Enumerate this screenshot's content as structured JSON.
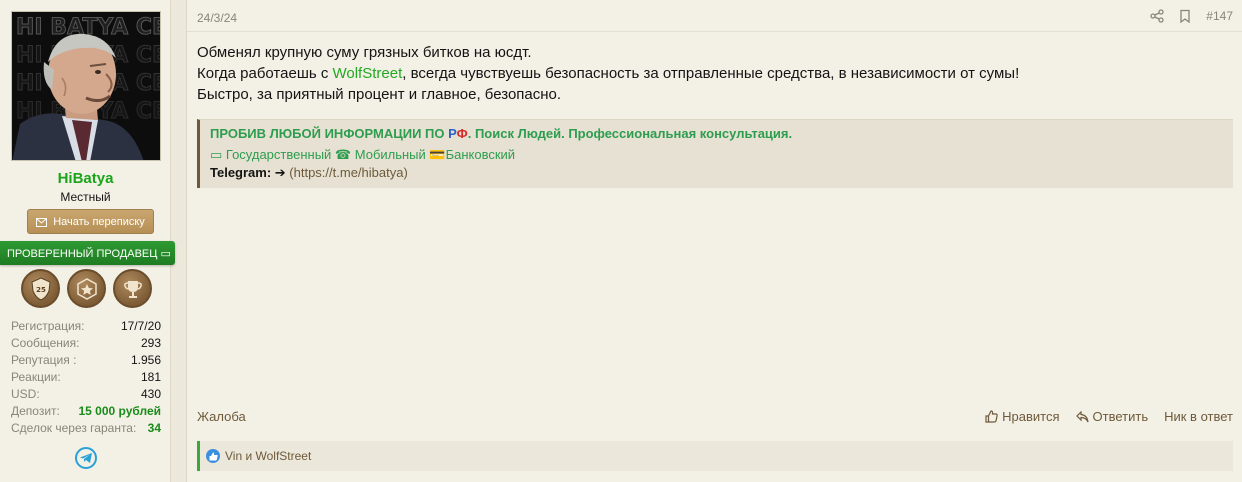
{
  "user": {
    "avatar_text": "HI BATYA СЕРВИС",
    "username": "HiBatya",
    "title": "Местный",
    "pm_button": "Начать переписку",
    "verified_label": "ПРОВЕРЕННЫЙ ПРОДАВЕЦ ▭",
    "trophy_number": "25",
    "stats": [
      {
        "label": "Регистрация:",
        "value": "17/7/20",
        "highlight": false
      },
      {
        "label": "Сообщения:",
        "value": "293",
        "highlight": false
      },
      {
        "label": "Репутация :",
        "value": "1.956",
        "highlight": false
      },
      {
        "label": "Реакции:",
        "value": "181",
        "highlight": false
      },
      {
        "label": "USD:",
        "value": "430",
        "highlight": false
      },
      {
        "label": "Депозит:",
        "value": "15 000 рублей",
        "highlight": true
      },
      {
        "label": "Сделок через гаранта:",
        "value": "34",
        "highlight": true
      }
    ]
  },
  "post": {
    "date": "24/3/24",
    "number": "#147",
    "line1": "Обменял крупную суму грязных битков на юсдт.",
    "line2_before": "Когда работаешь с ",
    "line2_mention": "WolfStreet",
    "line2_after": ", всегда чувствуешь безопасность за отправленные средства, в независимости от сумы!",
    "line3": "Быстро, за приятный процент и главное, безопасно."
  },
  "signature": {
    "title_before": "ПРОБИВ ЛЮБОЙ ИНФОРМАЦИИ ПО ",
    "title_r": "Р",
    "title_f": "Ф",
    "title_after": ". Поиск Людей. Профессиональная консультация.",
    "services": "▭ Государственный ☎ Мобильный 💳Банковский",
    "telegram_label": "Telegram:",
    "telegram_arrow": " ➔ ",
    "telegram_link": "(https://t.me/hibatya)"
  },
  "footer": {
    "report": "Жалоба",
    "like": "Нравится",
    "reply": "Ответить",
    "mention": "Ник в ответ"
  },
  "reactions": {
    "text": "Vin и WolfStreet"
  },
  "colors": {
    "username": "#1aa51a",
    "verified": "#2e9a32",
    "accent": "#6e5a3a"
  }
}
